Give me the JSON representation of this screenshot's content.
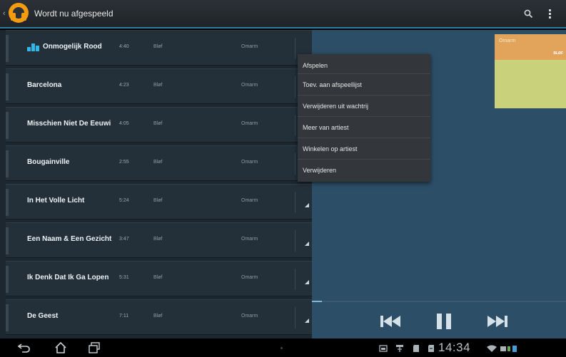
{
  "actionbar": {
    "title": "Wordt nu afgespeeld",
    "up_icon": "up-arrow-icon",
    "app_icon": "headphones-icon",
    "search_icon": "search-icon",
    "overflow_icon": "overflow-menu-icon",
    "accent": "#2e7fa6"
  },
  "tracks": [
    {
      "name": "Onmogelijk Rood",
      "duration": "4:40",
      "artist": "Bløf",
      "album": "Omarm",
      "playing": true
    },
    {
      "name": "Barcelona",
      "duration": "4:23",
      "artist": "Bløf",
      "album": "Omarm"
    },
    {
      "name": "Misschien Niet De Eeuwi",
      "duration": "4:05",
      "artist": "Bløf",
      "album": "Omarm"
    },
    {
      "name": "Bougainville",
      "duration": "2:55",
      "artist": "Bløf",
      "album": "Omarm"
    },
    {
      "name": "In Het Volle Licht",
      "duration": "5:24",
      "artist": "Bløf",
      "album": "Omarm"
    },
    {
      "name": "Een Naam & Een Gezicht",
      "duration": "3:47",
      "artist": "Bløf",
      "album": "Omarm"
    },
    {
      "name": "Ik Denk Dat Ik Ga Lopen",
      "duration": "5:31",
      "artist": "Bløf",
      "album": "Omarm"
    },
    {
      "name": "De Geest",
      "duration": "7:11",
      "artist": "Bløf",
      "album": "Omarm"
    }
  ],
  "context_menu": {
    "items": [
      "Afspelen",
      "Toev. aan afspeellijst",
      "Verwijderen uit wachtrij",
      "Meer van artiest",
      "Winkelen op artiest",
      "Verwijderen"
    ]
  },
  "now_playing": {
    "album_title": "Omarm",
    "album_sub": "BLØF",
    "album_colors": {
      "strip": "#e2a35a",
      "body": "#c9d27a"
    },
    "progress": 0.04,
    "controls": [
      "previous-icon",
      "pause-icon",
      "next-icon"
    ]
  },
  "system_bar": {
    "clock": "14:34",
    "nav_icons": [
      "back-icon",
      "home-icon",
      "recent-apps-icon"
    ],
    "status_icons": [
      "screenshot-icon",
      "usb-icon",
      "sdcard-icon",
      "download-icon",
      "wifi-icon",
      "battery-icon"
    ]
  }
}
